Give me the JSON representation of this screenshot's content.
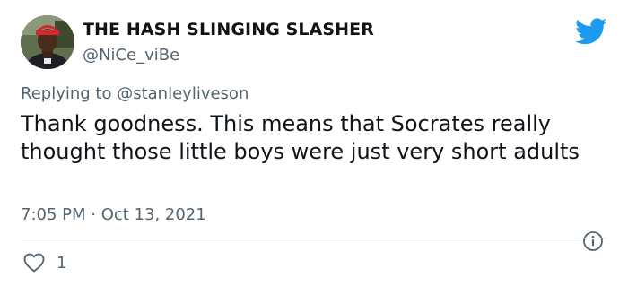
{
  "author": {
    "display_name": "THE HASH SLINGING SLASHER",
    "handle": "@NiCe_viBe",
    "avatar_icon": "profile-photo"
  },
  "reply": {
    "prefix": "Replying to",
    "mention": "@stanleyliveson"
  },
  "tweet": {
    "text": "Thank goodness. This means that Socrates really thought those little boys were just very short adults",
    "timestamp": "7:05 PM · Oct 13, 2021"
  },
  "engagement": {
    "likes": "1"
  },
  "icons": {
    "brand": "twitter-bird-icon",
    "info": "info-icon",
    "like": "heart-icon"
  },
  "colors": {
    "brand_blue": "#1d9bf0",
    "secondary_text": "#536471",
    "primary_text": "#0f1419"
  }
}
